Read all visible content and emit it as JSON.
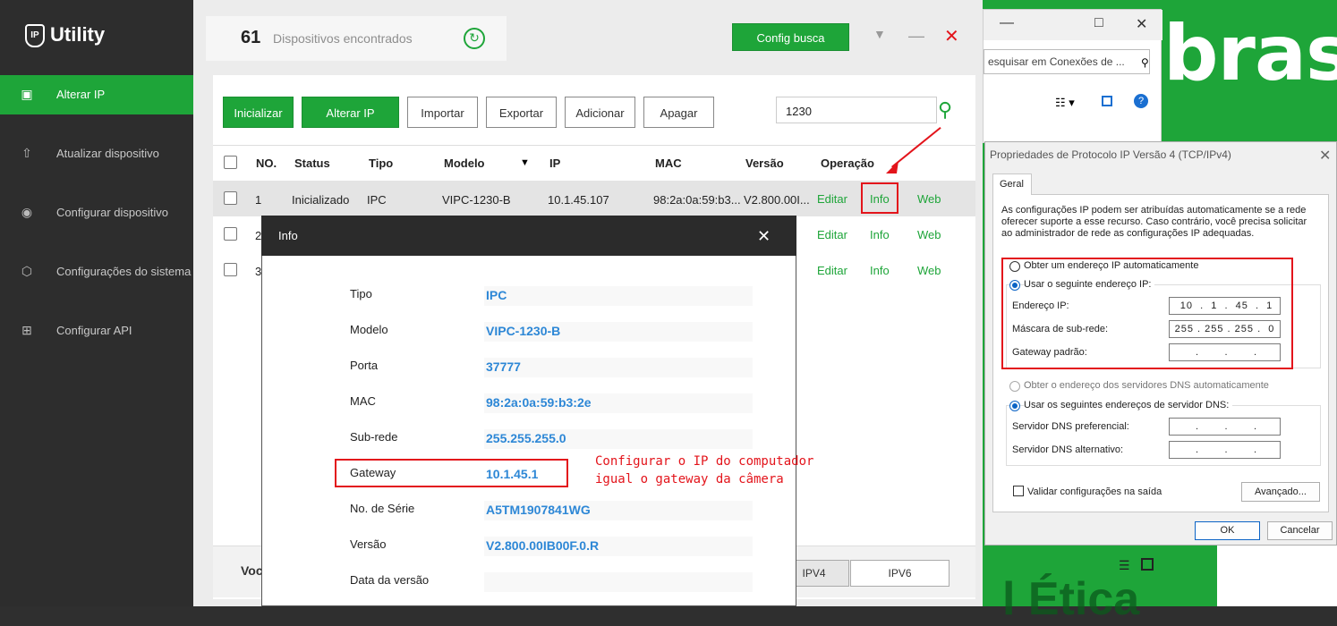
{
  "brand": {
    "word": "bras",
    "bottom_word": "l     Ética"
  },
  "explorer": {
    "search_placeholder": "esquisar em Conexões de ..."
  },
  "sidebar": {
    "logo": "Utility",
    "logo_badge": "IP",
    "items": [
      {
        "label": "Alterar IP",
        "icon": "ip-icon",
        "active": true
      },
      {
        "label": "Atualizar dispositivo",
        "icon": "upload-icon"
      },
      {
        "label": "Configurar dispositivo",
        "icon": "target-icon"
      },
      {
        "label": "Configurações do sistema",
        "icon": "gear-icon"
      },
      {
        "label": "Configurar API",
        "icon": "grid-icon"
      }
    ]
  },
  "header": {
    "count": "61",
    "count_label": "Dispositivos encontrados",
    "config_button": "Config busca"
  },
  "toolbar": {
    "inicializar": "Inicializar",
    "alterar_ip": "Alterar IP",
    "importar": "Importar",
    "exportar": "Exportar",
    "adicionar": "Adicionar",
    "apagar": "Apagar",
    "search_value": "1230"
  },
  "table": {
    "headers": {
      "no": "NO.",
      "status": "Status",
      "tipo": "Tipo",
      "modelo": "Modelo",
      "ip": "IP",
      "mac": "MAC",
      "versao": "Versão",
      "operacao": "Operação"
    },
    "rows": [
      {
        "no": "1",
        "status": "Inicializado",
        "tipo": "IPC",
        "modelo": "VIPC-1230-B",
        "ip": "10.1.45.107",
        "mac": "98:2a:0a:59:b3...",
        "versao": "V2.800.00I...",
        "editar": "Editar",
        "info": "Info",
        "web": "Web"
      },
      {
        "no": "2",
        "editar": "Editar",
        "info": "Info",
        "web": "Web"
      },
      {
        "no": "3",
        "editar": "Editar",
        "info": "Info",
        "web": "Web"
      }
    ]
  },
  "bottom": {
    "left_text": "Voc",
    "ipv4": "IPV4",
    "ipv6": "IPV6"
  },
  "modal": {
    "title": "Info",
    "fields": [
      {
        "key": "Tipo",
        "value": "IPC"
      },
      {
        "key": "Modelo",
        "value": "VIPC-1230-B"
      },
      {
        "key": "Porta",
        "value": "37777"
      },
      {
        "key": "MAC",
        "value": "98:2a:0a:59:b3:2e"
      },
      {
        "key": "Sub-rede",
        "value": "255.255.255.0"
      },
      {
        "key": "Gateway",
        "value": "10.1.45.1"
      },
      {
        "key": "No. de Série",
        "value": "A5TM1907841WG"
      },
      {
        "key": "Versão",
        "value": "V2.800.00IB00F.0.R"
      },
      {
        "key": "Data da versão",
        "value": ""
      }
    ]
  },
  "annotation": {
    "line1": "Configurar o IP do computador",
    "line2": "igual o gateway da câmera"
  },
  "tcpip": {
    "title": "Propriedades de Protocolo IP Versão 4 (TCP/IPv4)",
    "tab": "Geral",
    "intro": "As configurações IP podem ser atribuídas automaticamente se a rede oferecer suporte a esse recurso. Caso contrário, você precisa solicitar ao administrador de rede as configurações IP adequadas.",
    "auto_ip": "Obter um endereço IP automaticamente",
    "manual_ip": "Usar o seguinte endereço IP:",
    "ip_label": "Endereço IP:",
    "ip_value": " 10  .  1  .  45  .  1",
    "mask_label": "Máscara de sub-rede:",
    "mask_value": "255 . 255 . 255 .  0",
    "gw_label": "Gateway padrão:",
    "gw_value": " .       .       .",
    "auto_dns": "Obter o endereço dos servidores DNS automaticamente",
    "manual_dns": "Usar os seguintes endereços de servidor DNS:",
    "dns1_label": "Servidor DNS preferencial:",
    "dns1_value": " .       .       .",
    "dns2_label": "Servidor DNS alternativo:",
    "dns2_value": " .       .       .",
    "validate": "Validar configurações na saída",
    "advanced": "Avançado...",
    "ok": "OK",
    "cancel": "Cancelar"
  }
}
